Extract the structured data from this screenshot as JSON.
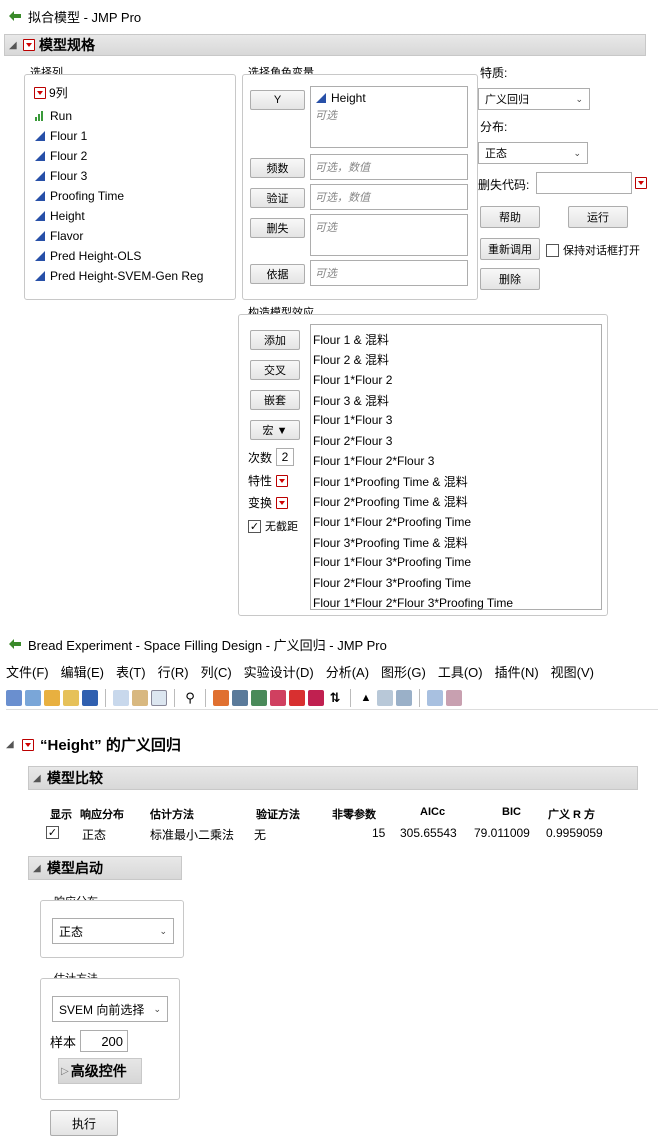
{
  "window1": {
    "title": "拟合模型 - JMP Pro"
  },
  "spec": {
    "section_title": "模型规格",
    "select_columns": {
      "label": "选择列",
      "count": "9列",
      "items": [
        {
          "name": "Run",
          "icon": "continuous-green-icon"
        },
        {
          "name": "Flour 1",
          "icon": "continuous-blue-icon"
        },
        {
          "name": "Flour 2",
          "icon": "continuous-blue-icon"
        },
        {
          "name": "Flour 3",
          "icon": "continuous-blue-icon"
        },
        {
          "name": "Proofing Time",
          "icon": "continuous-blue-icon"
        },
        {
          "name": "Height",
          "icon": "continuous-blue-icon"
        },
        {
          "name": "Flavor",
          "icon": "continuous-blue-icon"
        },
        {
          "name": "Pred Height-OLS",
          "icon": "continuous-blue-icon"
        },
        {
          "name": "Pred Height-SVEM-Gen Reg",
          "icon": "continuous-blue-icon"
        }
      ]
    },
    "roles": {
      "label": "选择角色变量",
      "y_button": "Y",
      "y_value": "Height",
      "optional": "可选",
      "freq_button": "频数",
      "optional_numeric": "可选，数值",
      "validation_button": "验证",
      "censor_button": "删失",
      "by_button": "依据"
    },
    "personality": {
      "label": "特质:",
      "value": "广义回归",
      "dist_label": "分布:",
      "dist_value": "正态",
      "missing_label": "删失代码:",
      "help_button": "帮助",
      "run_button": "运行",
      "recall_button": "重新调用",
      "keep_open_label": "保持对话框打开",
      "remove_button": "删除"
    },
    "effects": {
      "label": "构造模型效应",
      "add_button": "添加",
      "cross_button": "交叉",
      "nest_button": "嵌套",
      "macros_button": "宏 ▼",
      "degree_label": "次数",
      "degree_value": "2",
      "attributes_label": "特性",
      "transform_label": "变换",
      "no_intercept_label": "无截距",
      "items": [
        "Flour 1 & 混料",
        "Flour 2 & 混料",
        "Flour 1*Flour 2",
        "Flour 3 & 混料",
        "Flour 1*Flour 3",
        "Flour 2*Flour 3",
        "Flour 1*Flour 2*Flour 3",
        "Flour 1*Proofing Time & 混料",
        "Flour 2*Proofing Time & 混料",
        "Flour 1*Flour 2*Proofing Time",
        "Flour 3*Proofing Time & 混料",
        "Flour 1*Flour 3*Proofing Time",
        "Flour 2*Flour 3*Proofing Time",
        "Flour 1*Flour 2*Flour 3*Proofing Time"
      ]
    }
  },
  "window2": {
    "title": "Bread Experiment - Space Filling Design - 广义回归 - JMP Pro",
    "menu": [
      "文件(F)",
      "编辑(E)",
      "表(T)",
      "行(R)",
      "列(C)",
      "实验设计(D)",
      "分析(A)",
      "图形(G)",
      "工具(O)",
      "插件(N)",
      "视图(V)"
    ],
    "report_title": "“Height” 的广义回归",
    "comparison": {
      "title": "模型比较",
      "headers": [
        "显示",
        "响应分布",
        "估计方法",
        "验证方法",
        "非零参数",
        "AICc",
        "BIC",
        "广义 R 方"
      ],
      "row": {
        "distribution": "正态",
        "estimation": "标准最小二乘法",
        "validation": "无",
        "nonzero": "15",
        "aicc": "305.65543",
        "bic": "79.011009",
        "rsq": "0.9959059"
      }
    },
    "launch": {
      "title": "模型启动",
      "response_dist_label": "响应分布",
      "response_dist_value": "正态",
      "estimation_label": "估计方法",
      "estimation_value": "SVEM 向前选择",
      "samples_label": "样本",
      "samples_value": "200",
      "advanced_label": "高级控件",
      "go_button": "执行"
    }
  }
}
